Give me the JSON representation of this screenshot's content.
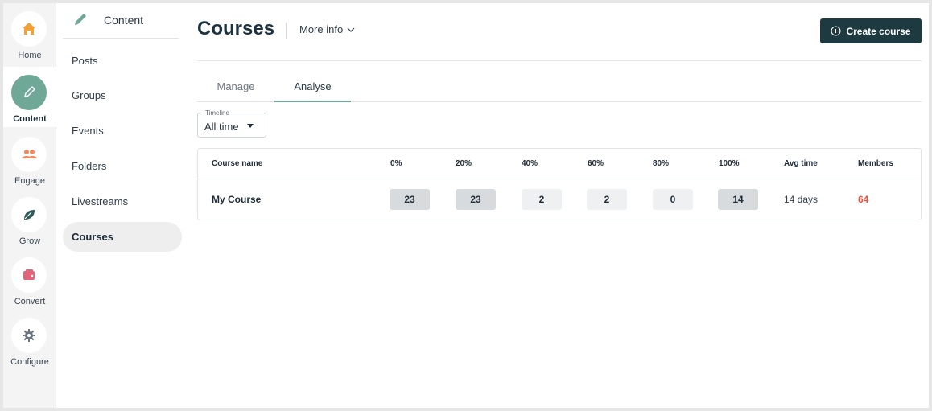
{
  "rail": {
    "items": [
      {
        "label": "Home",
        "icon": "home-icon",
        "active": false
      },
      {
        "label": "Content",
        "icon": "pencil-icon",
        "active": true
      },
      {
        "label": "Engage",
        "icon": "people-icon",
        "active": false
      },
      {
        "label": "Grow",
        "icon": "leaf-icon",
        "active": false
      },
      {
        "label": "Convert",
        "icon": "wallet-icon",
        "active": false
      },
      {
        "label": "Configure",
        "icon": "gear-icon",
        "active": false
      }
    ]
  },
  "subnav": {
    "title": "Content",
    "items": [
      {
        "label": "Posts",
        "active": false
      },
      {
        "label": "Groups",
        "active": false
      },
      {
        "label": "Events",
        "active": false
      },
      {
        "label": "Folders",
        "active": false
      },
      {
        "label": "Livestreams",
        "active": false
      },
      {
        "label": "Courses",
        "active": true
      }
    ]
  },
  "header": {
    "title": "Courses",
    "more_info": "More info",
    "create_button": "Create course"
  },
  "tabs": [
    {
      "label": "Manage",
      "active": false
    },
    {
      "label": "Analyse",
      "active": true
    }
  ],
  "timeline": {
    "legend": "Timeline",
    "value": "All time"
  },
  "table": {
    "headers": [
      "Course name",
      "0%",
      "20%",
      "40%",
      "60%",
      "80%",
      "100%",
      "Avg time",
      "Members"
    ],
    "rows": [
      {
        "name": "My Course",
        "progress_counts": [
          "23",
          "23",
          "2",
          "2",
          "0",
          "14"
        ],
        "avg_time": "14 days",
        "members": "64"
      }
    ]
  },
  "colors": {
    "accent": "#6fa896",
    "primary_button": "#1d3a40",
    "members_text": "#e0553f",
    "home_icon": "#f2a13a",
    "engage_icon": "#f08a5d",
    "grow_icon": "#2f5a5a",
    "convert_icon": "#e2647a",
    "configure_icon": "#6b7480"
  }
}
